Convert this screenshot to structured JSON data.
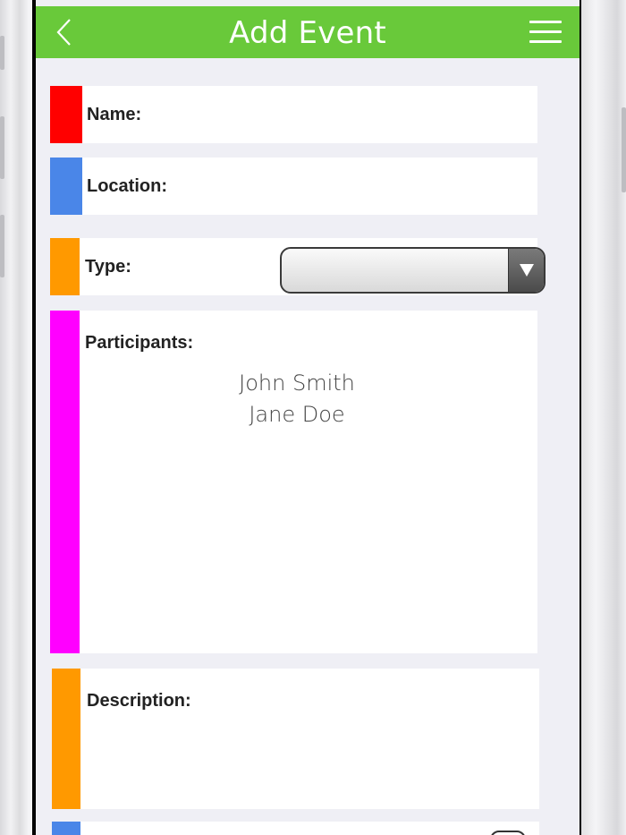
{
  "header": {
    "title": "Add Event",
    "back_icon": "chevron-left-icon",
    "menu_icon": "hamburger-menu-icon",
    "color": "#69c93a"
  },
  "form": {
    "name": {
      "label": "Name:",
      "accent": "#ff0000"
    },
    "location": {
      "label": "Location:",
      "accent": "#4a86e8"
    },
    "type": {
      "label": "Type:",
      "accent": "#ff9900",
      "selected": ""
    },
    "participants": {
      "label": "Participants:",
      "accent": "#ff00ff",
      "items": [
        "John Smith",
        "Jane Doe"
      ]
    },
    "description": {
      "label": "Description:",
      "accent": "#ff9900"
    },
    "next_row": {
      "accent": "#4a86e8"
    }
  }
}
